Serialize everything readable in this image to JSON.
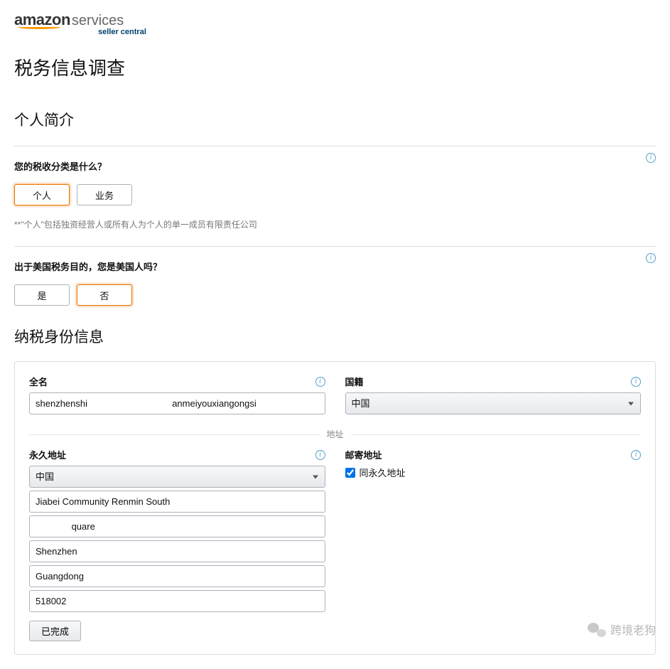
{
  "logo": {
    "brand": "amazon",
    "services": "services",
    "subtitle": "seller central"
  },
  "page_title": "税务信息调查",
  "section_profile": "个人简介",
  "q1": {
    "question": "您的税收分类是什么？",
    "option_individual": "个人",
    "option_business": "业务",
    "note": "**\"个人\"包括独资经营人或所有人为个人的单一成员有限责任公司"
  },
  "q2": {
    "question": "出于美国税务目的，您是美国人吗？",
    "option_yes": "是",
    "option_no": "否"
  },
  "section_tax_identity": "纳税身份信息",
  "identity": {
    "fullname_label": "全名",
    "fullname_value": "shenzhenshi                                 anmeiyouxiangongsi",
    "nationality_label": "国籍",
    "nationality_value": "中国"
  },
  "address_divider": "地址",
  "perm_addr": {
    "label": "永久地址",
    "country": "中国",
    "line1": "Jiabei Community Renmin South",
    "line2": "              quare",
    "city": "Shenzhen",
    "province": "Guangdong",
    "postal": "518002",
    "done_btn": "已完成"
  },
  "mail_addr": {
    "label": "邮寄地址",
    "same_checkbox_label": "同永久地址",
    "same_checked": true
  },
  "watermark": "跨境老狗"
}
